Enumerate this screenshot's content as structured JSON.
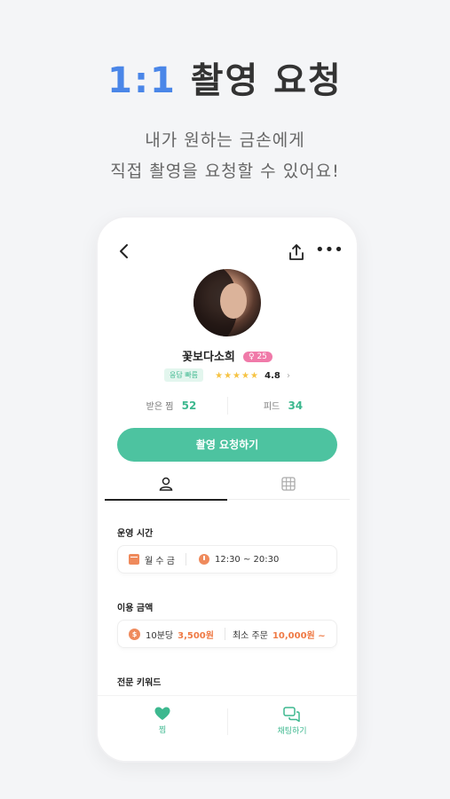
{
  "hero": {
    "title_accent": "1:1",
    "title_rest": "촬영 요청",
    "subtitle_line1": "내가 원하는 금손에게",
    "subtitle_line2": "직접 촬영을 요청할 수 있어요!"
  },
  "profile": {
    "name": "꽃보다소희",
    "gender_age": "♀ 25",
    "fast_badge": "응답 빠름",
    "stars": "★★★★★",
    "rating": "4.8"
  },
  "stats": {
    "received_label": "받은 찜",
    "received_value": "52",
    "feed_label": "피드",
    "feed_value": "34"
  },
  "request_button": "촬영 요청하기",
  "sections": {
    "hours_title": "운영 시간",
    "days": "월 수 금",
    "hours": "12:30 ~ 20:30",
    "price_title": "이용 금액",
    "coin_symbol": "$",
    "price_unit": "10분당",
    "price_value": "3,500원",
    "min_order_label": "최소 주문",
    "min_order_value": "10,000원 ~",
    "keywords_title": "전문 키워드"
  },
  "bottom_nav": {
    "like_label": "찜",
    "chat_label": "채팅하기"
  },
  "colors": {
    "accent_blue": "#4a86e8",
    "primary_green": "#4dc3a0",
    "orange": "#ef7a45",
    "pink_badge": "#f07aa9"
  },
  "icons": [
    "back-icon",
    "share-icon",
    "more-icon",
    "profile-tab-icon",
    "grid-tab-icon",
    "calendar-icon",
    "clock-icon",
    "coin-icon",
    "heart-icon",
    "chat-icon",
    "star-icon"
  ]
}
